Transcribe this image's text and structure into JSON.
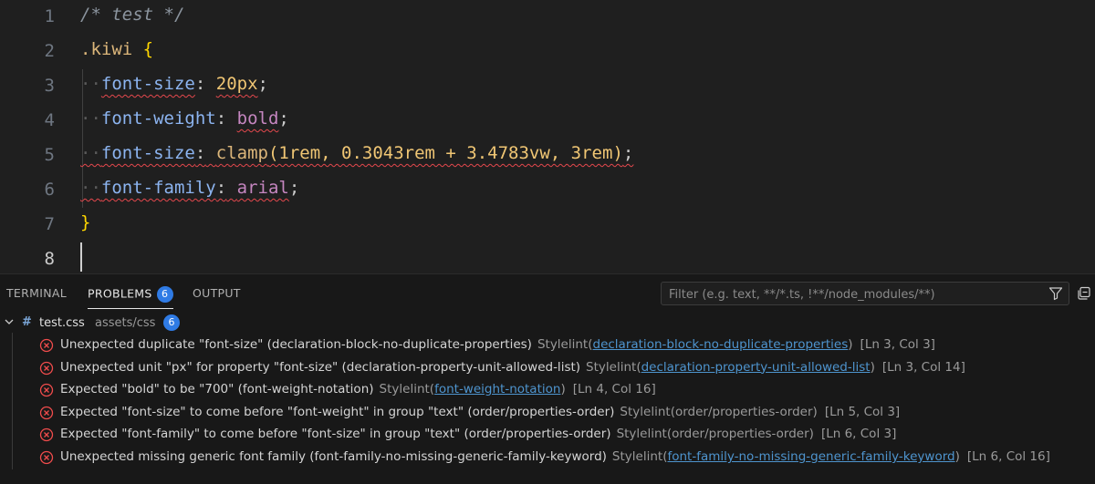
{
  "editor": {
    "lines": [
      {
        "num": "1",
        "comment": "/* test */"
      },
      {
        "num": "2",
        "selector": ".kiwi",
        "brace": "{"
      },
      {
        "num": "3",
        "indent": "··",
        "prop": "font-size",
        "colon": ":",
        "value": "20px",
        "semi": ";"
      },
      {
        "num": "4",
        "indent": "··",
        "prop": "font-weight",
        "colon": ":",
        "value": "bold",
        "semi": ";"
      },
      {
        "num": "5",
        "indent": "··",
        "prop": "font-size",
        "colon": ":",
        "fn": "clamp",
        "args": "(1rem, 0.3043rem + 3.4783vw, 3rem)",
        "semi": ";"
      },
      {
        "num": "6",
        "indent": "··",
        "prop": "font-family",
        "colon": ":",
        "value": "arial",
        "semi": ";"
      },
      {
        "num": "7",
        "brace": "}"
      },
      {
        "num": "8"
      }
    ]
  },
  "panel": {
    "tabs": [
      {
        "label": "TERMINAL"
      },
      {
        "label": "PROBLEMS",
        "badge": "6"
      },
      {
        "label": "OUTPUT"
      }
    ],
    "filter": {
      "placeholder": "Filter (e.g. text, **/*.ts, !**/node_modules/**)"
    },
    "file": {
      "name": "test.css",
      "path": "assets/css",
      "count": "6"
    },
    "problems": [
      {
        "message": "Unexpected duplicate \"font-size\" (declaration-block-no-duplicate-properties)",
        "source": "Stylelint",
        "rule": "declaration-block-no-duplicate-properties",
        "linked": true,
        "location": "[Ln 3, Col 3]"
      },
      {
        "message": "Unexpected unit \"px\" for property \"font-size\" (declaration-property-unit-allowed-list)",
        "source": "Stylelint",
        "rule": "declaration-property-unit-allowed-list",
        "linked": true,
        "location": "[Ln 3, Col 14]"
      },
      {
        "message": "Expected \"bold\" to be \"700\" (font-weight-notation)",
        "source": "Stylelint",
        "rule": "font-weight-notation",
        "linked": true,
        "location": "[Ln 4, Col 16]"
      },
      {
        "message": "Expected \"font-size\" to come before \"font-weight\" in group \"text\" (order/properties-order)",
        "source": "Stylelint",
        "rule": "order/properties-order",
        "linked": false,
        "location": "[Ln 5, Col 3]"
      },
      {
        "message": "Expected \"font-family\" to come before \"font-size\" in group \"text\" (order/properties-order)",
        "source": "Stylelint",
        "rule": "order/properties-order",
        "linked": false,
        "location": "[Ln 6, Col 3]"
      },
      {
        "message": "Unexpected missing generic font family (font-family-no-missing-generic-family-keyword)",
        "source": "Stylelint",
        "rule": "font-family-no-missing-generic-family-keyword",
        "linked": true,
        "location": "[Ln 6, Col 16]"
      }
    ]
  },
  "colors": {
    "badge": "#2f7be5",
    "error": "#e5484d",
    "link": "#4e94ce"
  }
}
